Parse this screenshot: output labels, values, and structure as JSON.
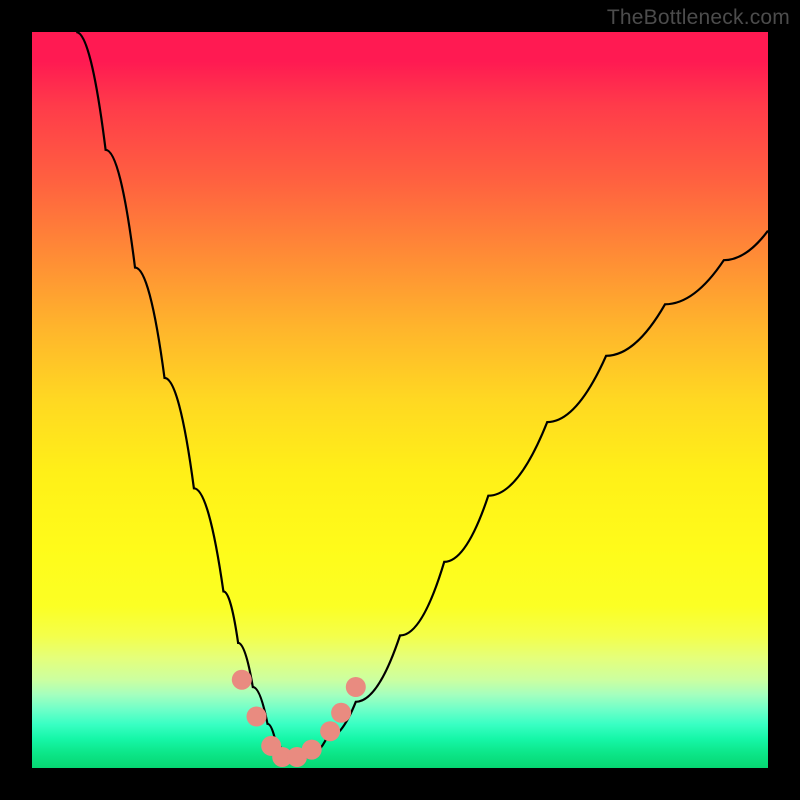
{
  "watermark": "TheBottleneck.com",
  "chart_data": {
    "type": "line",
    "title": "",
    "xlabel": "",
    "ylabel": "",
    "xlim": [
      0,
      100
    ],
    "ylim": [
      0,
      100
    ],
    "grid": false,
    "legend": false,
    "series": [
      {
        "name": "bottleneck-curve",
        "color": "#000000",
        "x": [
          6,
          10,
          14,
          18,
          22,
          26,
          28,
          30,
          32,
          33,
          34,
          35,
          36,
          38,
          40,
          44,
          50,
          56,
          62,
          70,
          78,
          86,
          94,
          100
        ],
        "y": [
          100,
          84,
          68,
          53,
          38,
          24,
          17,
          11,
          6,
          4,
          2,
          1,
          1,
          2,
          4,
          9,
          18,
          28,
          37,
          47,
          56,
          63,
          69,
          73
        ]
      }
    ],
    "markers": [
      {
        "name": "marker-1",
        "x": 28.5,
        "y": 12,
        "color": "#e98b80"
      },
      {
        "name": "marker-2",
        "x": 30.5,
        "y": 7,
        "color": "#e98b80"
      },
      {
        "name": "marker-3",
        "x": 32.5,
        "y": 3,
        "color": "#e98b80"
      },
      {
        "name": "marker-4",
        "x": 34.0,
        "y": 1.5,
        "color": "#e98b80"
      },
      {
        "name": "marker-5",
        "x": 36.0,
        "y": 1.5,
        "color": "#e98b80"
      },
      {
        "name": "marker-6",
        "x": 38.0,
        "y": 2.5,
        "color": "#e98b80"
      },
      {
        "name": "marker-7",
        "x": 40.5,
        "y": 5,
        "color": "#e98b80"
      },
      {
        "name": "marker-8",
        "x": 42.0,
        "y": 7.5,
        "color": "#e98b80"
      },
      {
        "name": "marker-9",
        "x": 44.0,
        "y": 11,
        "color": "#e98b80"
      }
    ],
    "gradient_bands": [
      {
        "name": "red",
        "from_y": 100,
        "to_y": 70
      },
      {
        "name": "orange",
        "from_y": 70,
        "to_y": 45
      },
      {
        "name": "yellow",
        "from_y": 45,
        "to_y": 15
      },
      {
        "name": "green",
        "from_y": 15,
        "to_y": 0
      }
    ]
  }
}
